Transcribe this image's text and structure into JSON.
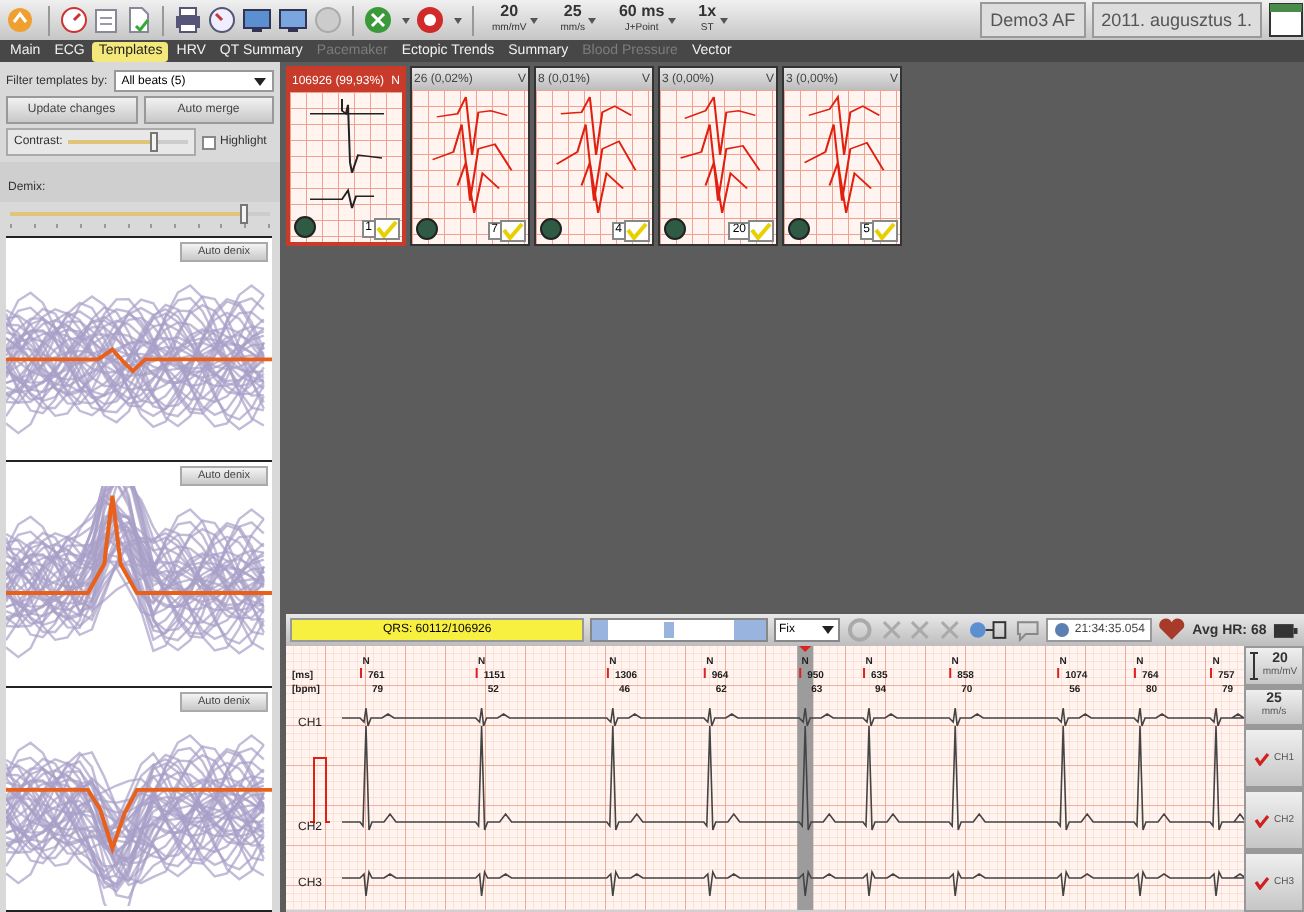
{
  "toolbar": {
    "settings": [
      {
        "value": "20",
        "unit": "mm/mV"
      },
      {
        "value": "25",
        "unit": "mm/s"
      },
      {
        "value": "60 ms",
        "unit": "J+Point"
      },
      {
        "value": "1x",
        "unit": "ST"
      }
    ],
    "patient": "Demo3 AF",
    "date": "2011. augusztus 1."
  },
  "tabs": [
    {
      "label": "Main",
      "selected": false,
      "disabled": false
    },
    {
      "label": "ECG",
      "selected": false,
      "disabled": false
    },
    {
      "label": "Templates",
      "selected": true,
      "disabled": false
    },
    {
      "label": "HRV",
      "selected": false,
      "disabled": false
    },
    {
      "label": "QT Summary",
      "selected": false,
      "disabled": false
    },
    {
      "label": "Pacemaker",
      "selected": false,
      "disabled": true
    },
    {
      "label": "Ectopic Trends",
      "selected": false,
      "disabled": false
    },
    {
      "label": "Summary",
      "selected": false,
      "disabled": false
    },
    {
      "label": "Blood Pressure",
      "selected": false,
      "disabled": true
    },
    {
      "label": "Vector",
      "selected": false,
      "disabled": false
    }
  ],
  "filter": {
    "label": "Filter templates by:",
    "value": "All beats (5)"
  },
  "buttons": [
    "Update changes",
    "Auto merge"
  ],
  "contrast": {
    "label": "Contrast:",
    "level": 0.72
  },
  "highlight": {
    "label": "Highlight",
    "checked": false
  },
  "demix": {
    "label": "Demix:",
    "level": 0.9
  },
  "denix_panels": [
    {
      "button": "Auto denix",
      "kind": "flat"
    },
    {
      "button": "Auto denix",
      "kind": "peak"
    },
    {
      "button": "Auto denix",
      "kind": "dip"
    }
  ],
  "templates": [
    {
      "count": "106926 (99,93%)",
      "type": "N",
      "selected": true,
      "number": "1",
      "checked": true,
      "kind": "normal"
    },
    {
      "count": "26 (0,02%)",
      "type": "V",
      "selected": false,
      "number": "7",
      "checked": true,
      "kind": "ventricular"
    },
    {
      "count": "8 (0,01%)",
      "type": "V",
      "selected": false,
      "number": "4",
      "checked": true,
      "kind": "ventricular"
    },
    {
      "count": "3 (0,00%)",
      "type": "V",
      "selected": false,
      "number": "20",
      "checked": true,
      "kind": "ventricular"
    },
    {
      "count": "3 (0,00%)",
      "type": "V",
      "selected": false,
      "number": "5",
      "checked": true,
      "kind": "ventricular"
    }
  ],
  "ecg": {
    "qrs": "QRS: 60112/106926",
    "mode": "Fix",
    "time": "21:34:35.054",
    "avg_hr": "Avg HR: 68",
    "axis_labels": [
      "[ms]",
      "[bpm]"
    ],
    "beats": [
      {
        "type": "N",
        "ms": "761",
        "bpm": "79",
        "selected": false
      },
      {
        "type": "N",
        "ms": "1151",
        "bpm": "52",
        "selected": false
      },
      {
        "type": "N",
        "ms": "1306",
        "bpm": "46",
        "selected": false
      },
      {
        "type": "N",
        "ms": "964",
        "bpm": "62",
        "selected": false
      },
      {
        "type": "N",
        "ms": "950",
        "bpm": "63",
        "selected": true
      },
      {
        "type": "N",
        "ms": "635",
        "bpm": "94",
        "selected": false
      },
      {
        "type": "N",
        "ms": "858",
        "bpm": "70",
        "selected": false
      },
      {
        "type": "N",
        "ms": "1074",
        "bpm": "56",
        "selected": false
      },
      {
        "type": "N",
        "ms": "764",
        "bpm": "80",
        "selected": false
      },
      {
        "type": "N",
        "ms": "757",
        "bpm": "79",
        "selected": false
      }
    ],
    "scale": [
      {
        "value": "20",
        "unit": "mm/mV"
      },
      {
        "value": "25",
        "unit": "mm/s"
      }
    ],
    "channels": [
      {
        "name": "CH1"
      },
      {
        "name": "CH2"
      },
      {
        "name": "CH3"
      }
    ],
    "channel_toggles": [
      {
        "name": "CH1",
        "checked": true
      },
      {
        "name": "CH2",
        "checked": true
      },
      {
        "name": "CH3",
        "checked": true
      }
    ]
  }
}
